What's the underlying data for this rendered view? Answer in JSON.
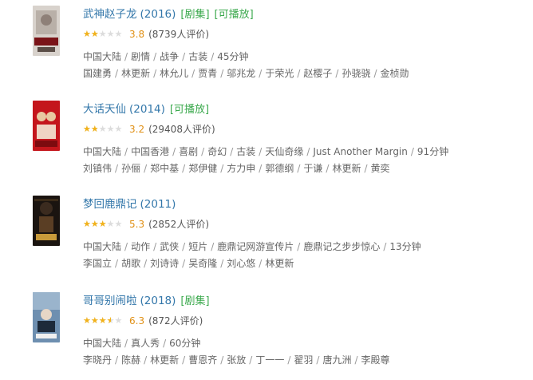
{
  "results": [
    {
      "title": "武神赵子龙",
      "year": "(2016)",
      "tags": [
        "[剧集]",
        "[可播放]"
      ],
      "rating": 3.8,
      "rating_text": "3.8",
      "votes": "(8739人评价)",
      "meta": [
        "中国大陆",
        "剧情",
        "战争",
        "古装",
        "45分钟"
      ],
      "cast": [
        "国建勇",
        "林更新",
        "林允儿",
        "贾青",
        "邬兆龙",
        "于荣光",
        "赵樱子",
        "孙骁骁",
        "金桢勋"
      ],
      "poster_colors": [
        "#d8d2cc",
        "#7a1418"
      ]
    },
    {
      "title": "大话天仙",
      "year": "(2014)",
      "tags": [
        "[可播放]"
      ],
      "rating": 3.2,
      "rating_text": "3.2",
      "votes": "(29408人评价)",
      "meta": [
        "中国大陆",
        "中国香港",
        "喜剧",
        "奇幻",
        "古装",
        "天仙奇缘",
        "Just Another Margin",
        "91分钟"
      ],
      "cast": [
        "刘镇伟",
        "孙俪",
        "郑中基",
        "郑伊健",
        "方力申",
        "郭德纲",
        "于谦",
        "林更新",
        "黄奕"
      ],
      "poster_colors": [
        "#c4161c",
        "#e8c9a0"
      ]
    },
    {
      "title": "梦回鹿鼎记",
      "year": "(2011)",
      "tags": [],
      "rating": 5.3,
      "rating_text": "5.3",
      "votes": "(2852人评价)",
      "meta": [
        "中国大陆",
        "动作",
        "武侠",
        "短片",
        "鹿鼎记网游宣传片",
        "鹿鼎记之步步惊心",
        "13分钟"
      ],
      "cast": [
        "李国立",
        "胡歌",
        "刘诗诗",
        "吴奇隆",
        "刘心悠",
        "林更新"
      ],
      "poster_colors": [
        "#1a1410",
        "#c89a3a"
      ]
    },
    {
      "title": "哥哥别闹啦",
      "year": "(2018)",
      "tags": [
        "[剧集]"
      ],
      "rating": 6.3,
      "rating_text": "6.3",
      "votes": "(872人评价)",
      "meta": [
        "中国大陆",
        "真人秀",
        "60分钟"
      ],
      "cast": [
        "李晓丹",
        "陈赫",
        "林更新",
        "曹恩齐",
        "张放",
        "丁一一",
        "翟羽",
        "唐九洲",
        "李殿尊"
      ],
      "poster_colors": [
        "#6e8fb0",
        "#1d2a3a"
      ]
    }
  ],
  "star_glyphs": "★★★★★"
}
